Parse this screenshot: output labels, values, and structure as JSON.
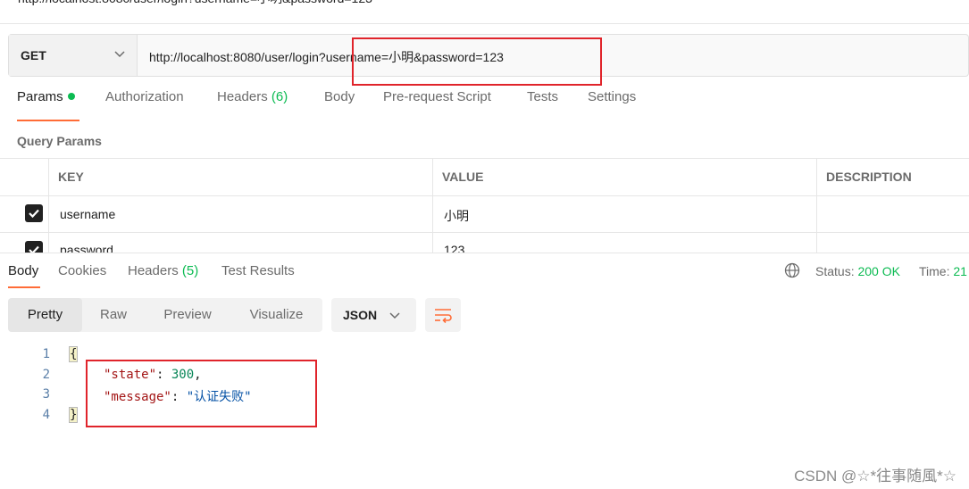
{
  "window": {
    "clipped_title": "http://localhost:8080/user/login?username=小明&password=123"
  },
  "request": {
    "method": "GET",
    "url": "http://localhost:8080/user/login?username=小明&password=123"
  },
  "request_tabs": {
    "params": "Params",
    "authorization": "Authorization",
    "headers": "Headers",
    "headers_count": "(6)",
    "body": "Body",
    "prerequest": "Pre-request Script",
    "tests": "Tests",
    "settings": "Settings"
  },
  "query_params": {
    "title": "Query Params",
    "columns": {
      "key": "KEY",
      "value": "VALUE",
      "description": "DESCRIPTION"
    },
    "rows": [
      {
        "checked": true,
        "key": "username",
        "value": "小明",
        "description": ""
      },
      {
        "checked": true,
        "key": "password",
        "value": "123",
        "description": ""
      }
    ]
  },
  "response_tabs": {
    "body": "Body",
    "cookies": "Cookies",
    "headers": "Headers",
    "headers_count": "(5)",
    "test_results": "Test Results"
  },
  "response_meta": {
    "status_label": "Status:",
    "status_value": "200 OK",
    "time_label": "Time:",
    "time_value": "21"
  },
  "view_modes": {
    "pretty": "Pretty",
    "raw": "Raw",
    "preview": "Preview",
    "visualize": "Visualize"
  },
  "format": "JSON",
  "response_body": {
    "line_numbers": [
      "1",
      "2",
      "3",
      "4"
    ],
    "open_brace": "{",
    "close_brace": "}",
    "state_key": "\"state\"",
    "state_value": "300",
    "message_key": "\"message\"",
    "message_value": "\"认证失败\""
  },
  "watermark": "CSDN @☆*往事随風*☆",
  "colors": {
    "accent": "#ff6c37",
    "success": "#0cbb52",
    "annotation": "#e0242b"
  }
}
